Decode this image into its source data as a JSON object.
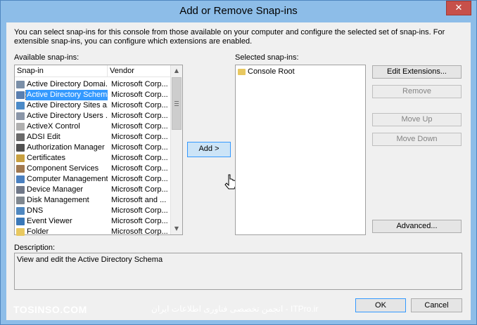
{
  "window": {
    "title": "Add or Remove Snap-ins",
    "close_label": "✕"
  },
  "description_text": "You can select snap-ins for this console from those available on your computer and configure the selected set of snap-ins. For extensible snap-ins, you can configure which extensions are enabled.",
  "available": {
    "label": "Available snap-ins:",
    "columns": [
      "Snap-in",
      "Vendor"
    ],
    "rows": [
      {
        "name": "Active Directory Domai...",
        "vendor": "Microsoft Corp...",
        "icon": "ad-domains-icon",
        "color": "#7a8fa8"
      },
      {
        "name": "Active Directory Schema",
        "vendor": "Microsoft Corp...",
        "icon": "ad-schema-icon",
        "color": "#5a7fb0"
      },
      {
        "name": "Active Directory Sites a...",
        "vendor": "Microsoft Corp...",
        "icon": "ad-sites-icon",
        "color": "#4a8ac8"
      },
      {
        "name": "Active Directory Users ...",
        "vendor": "Microsoft Corp...",
        "icon": "ad-users-icon",
        "color": "#8a96a8"
      },
      {
        "name": "ActiveX Control",
        "vendor": "Microsoft Corp...",
        "icon": "activex-icon",
        "color": "#b0b0b0"
      },
      {
        "name": "ADSI Edit",
        "vendor": "Microsoft Corp...",
        "icon": "adsi-icon",
        "color": "#6a6a6a"
      },
      {
        "name": "Authorization Manager",
        "vendor": "Microsoft Corp...",
        "icon": "authorization-icon",
        "color": "#505050"
      },
      {
        "name": "Certificates",
        "vendor": "Microsoft Corp...",
        "icon": "certificates-icon",
        "color": "#c8a040"
      },
      {
        "name": "Component Services",
        "vendor": "Microsoft Corp...",
        "icon": "component-services-icon",
        "color": "#a07850"
      },
      {
        "name": "Computer Management",
        "vendor": "Microsoft Corp...",
        "icon": "computer-management-icon",
        "color": "#4a80c0"
      },
      {
        "name": "Device Manager",
        "vendor": "Microsoft Corp...",
        "icon": "device-manager-icon",
        "color": "#707888"
      },
      {
        "name": "Disk Management",
        "vendor": "Microsoft and ...",
        "icon": "disk-management-icon",
        "color": "#808890"
      },
      {
        "name": "DNS",
        "vendor": "Microsoft Corp...",
        "icon": "dns-icon",
        "color": "#5088c0"
      },
      {
        "name": "Event Viewer",
        "vendor": "Microsoft Corp...",
        "icon": "event-viewer-icon",
        "color": "#3a78b8"
      },
      {
        "name": "Folder",
        "vendor": "Microsoft Corp...",
        "icon": "folder-icon",
        "color": "#e8c860"
      }
    ],
    "selected_index": 1
  },
  "selected": {
    "label": "Selected snap-ins:",
    "items": [
      {
        "name": "Console Root",
        "icon": "console-root-folder-icon"
      }
    ]
  },
  "buttons": {
    "add": "Add >",
    "edit_extensions": "Edit Extensions...",
    "remove": "Remove",
    "move_up": "Move Up",
    "move_down": "Move Down",
    "advanced": "Advanced...",
    "ok": "OK",
    "cancel": "Cancel"
  },
  "description": {
    "label": "Description:",
    "text": "View and edit the Active Directory Schema"
  },
  "watermark": {
    "left": "TOSINSO.COM",
    "middle": "انجمن تخصصی فناوری اطلاعات ایران - ITPro.ir"
  },
  "colors": {
    "titlebar": "#8dbde8",
    "selection": "#3399ff",
    "close": "#c7504a"
  }
}
